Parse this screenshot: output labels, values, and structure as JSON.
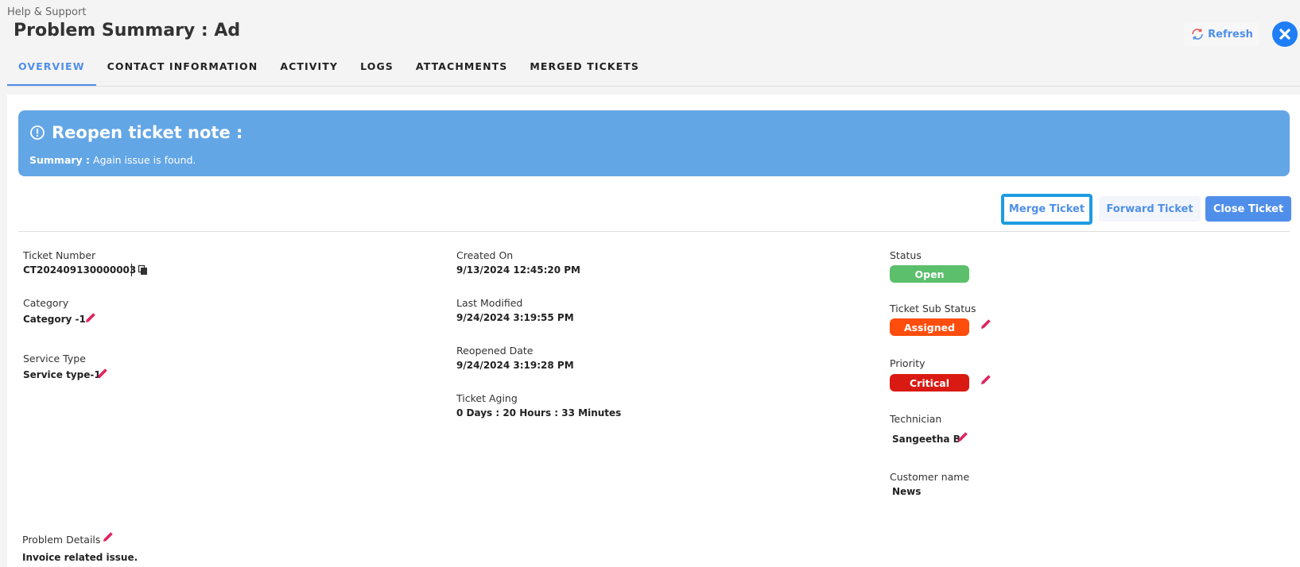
{
  "header": {
    "breadcrumb": "Help & Support",
    "title": "Problem Summary : Ad",
    "refresh_label": "Refresh",
    "close_icon": "close-circle-icon"
  },
  "tabs": [
    {
      "label": "OVERVIEW",
      "active": true
    },
    {
      "label": "CONTACT INFORMATION",
      "active": false
    },
    {
      "label": "ACTIVITY",
      "active": false
    },
    {
      "label": "LOGS",
      "active": false
    },
    {
      "label": "ATTACHMENTS",
      "active": false
    },
    {
      "label": "MERGED TICKETS",
      "active": false
    }
  ],
  "banner": {
    "title": "Reopen ticket note :",
    "summary_label": "Summary :",
    "summary_text": "Again issue is found."
  },
  "actions": {
    "merge": "Merge Ticket",
    "forward": "Forward Ticket",
    "close": "Close Ticket"
  },
  "details": {
    "ticket_number_label": "Ticket Number",
    "ticket_number": "CT202409130000003",
    "category_label": "Category",
    "category": "Category -1",
    "service_type_label": "Service Type",
    "service_type": "Service type-1",
    "created_on_label": "Created On",
    "created_on": "9/13/2024 12:45:20 PM",
    "last_modified_label": "Last Modified",
    "last_modified": "9/24/2024 3:19:55 PM",
    "reopened_date_label": "Reopened Date",
    "reopened_date": "9/24/2024 3:19:28 PM",
    "ticket_aging_label": "Ticket Aging",
    "ticket_aging": "0 Days : 20 Hours : 33 Minutes",
    "status_label": "Status",
    "status": "Open",
    "sub_status_label": "Ticket Sub Status",
    "sub_status": "Assigned",
    "priority_label": "Priority",
    "priority": "Critical",
    "technician_label": "Technician",
    "technician": "Sangeetha B",
    "customer_label": "Customer name",
    "customer": "News",
    "problem_label": "Problem Details",
    "problem": "Invoice related issue."
  },
  "colors": {
    "accent": "#4f8fea",
    "banner": "#63a6e6",
    "status_open": "#5cbf6b",
    "sub_status_assigned": "#ff4d0d",
    "priority_critical": "#d91a12",
    "pencil": "#e0245e"
  }
}
